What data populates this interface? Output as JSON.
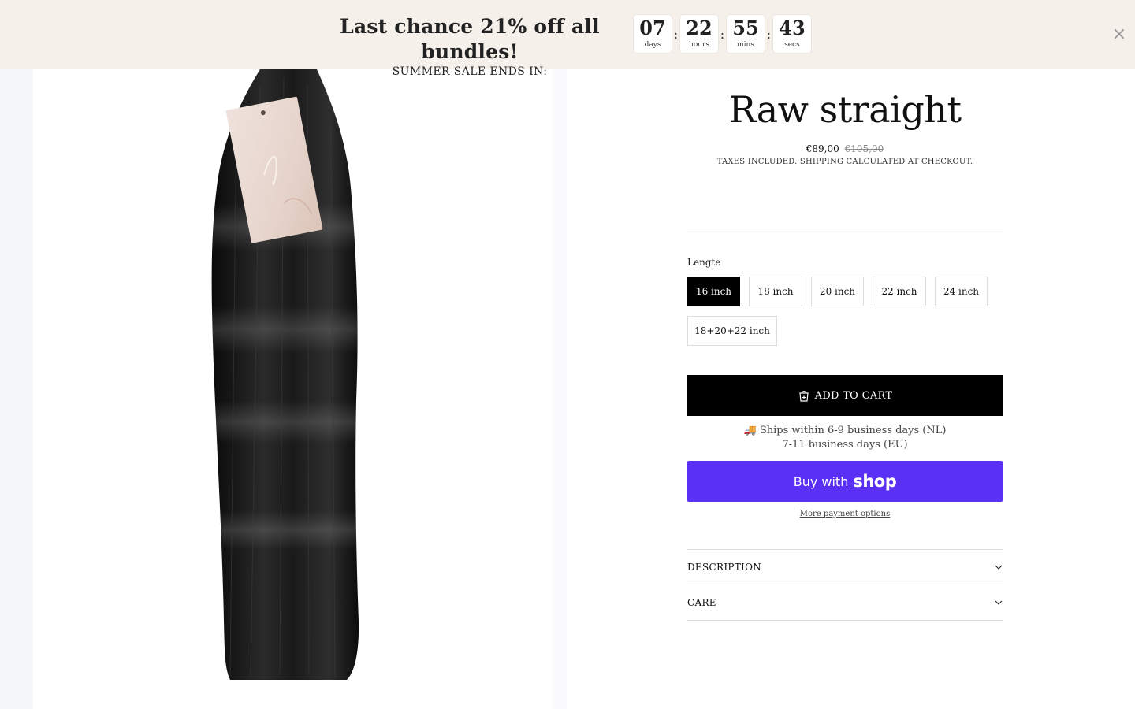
{
  "promo": {
    "title": "Last chance 21% off all bundles!",
    "subtitle": "SUMMER SALE ENDS IN:",
    "countdown": [
      {
        "value": "07",
        "unit": "days"
      },
      {
        "value": "22",
        "unit": "hours"
      },
      {
        "value": "55",
        "unit": "mins"
      },
      {
        "value": "43",
        "unit": "secs"
      }
    ],
    "separator": ":",
    "close_icon": "×",
    "background": "#f5f0ea"
  },
  "gallery": {
    "image": "straight-black-hair-bundle-with-tag"
  },
  "product": {
    "title": "Raw straight",
    "price": "€89,00",
    "compare_price": "€105,00",
    "tax_note": "TAXES INCLUDED. SHIPPING CALCULATED AT CHECKOUT.",
    "option_label": "Lengte",
    "variants": [
      {
        "label": "16 inch",
        "selected": true
      },
      {
        "label": "18 inch",
        "selected": false
      },
      {
        "label": "20 inch",
        "selected": false
      },
      {
        "label": "22 inch",
        "selected": false
      },
      {
        "label": "24 inch",
        "selected": false
      },
      {
        "label": "18+20+22 inch",
        "selected": false
      }
    ],
    "add_to_cart": "ADD TO CART",
    "shipping_line1": "🚚 Ships within 6-9 business days (NL)",
    "shipping_line2": "7-11 business days (EU)",
    "buy_with": "Buy with",
    "shop_logo": "shop",
    "shop_color": "#5a31f4",
    "more_payment": "More payment options",
    "accordions": [
      {
        "label": "DESCRIPTION",
        "icon": "chevron-down-icon"
      },
      {
        "label": "CARE",
        "icon": "chevron-down-icon"
      }
    ]
  }
}
